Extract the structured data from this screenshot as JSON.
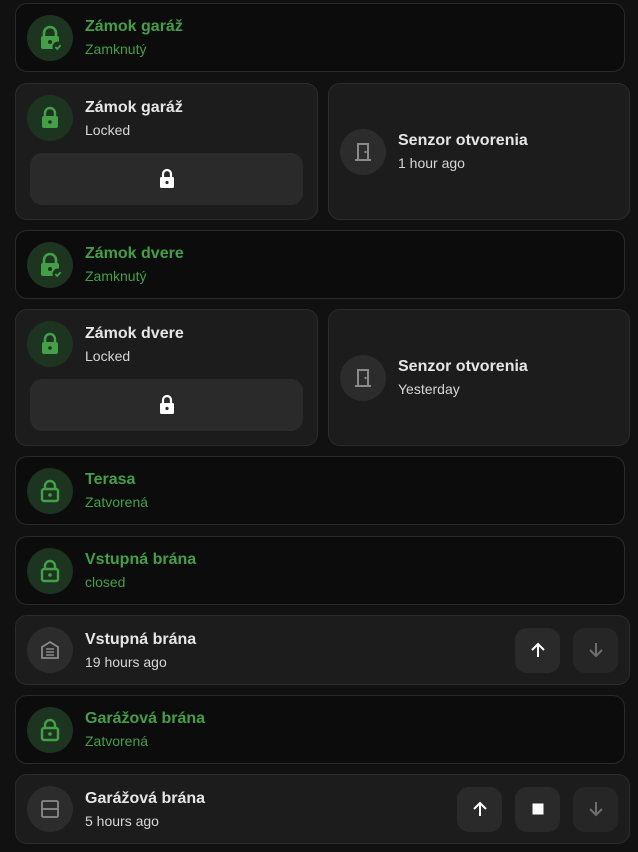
{
  "colors": {
    "accent_green": "#43a047",
    "card_dark": "#0c0c0c",
    "card_mid": "#1c1c1c"
  },
  "cards": [
    {
      "title": "Zámok garáž",
      "subtitle": "Zamknutý",
      "icon": "lock-check-icon"
    },
    {
      "title": "Zámok garáž",
      "subtitle": "Locked",
      "icon": "lock-icon",
      "button_icon": "lock-icon"
    },
    {
      "title": "Senzor otvorenia",
      "subtitle": "1 hour ago",
      "icon": "door-icon"
    },
    {
      "title": "Zámok dvere",
      "subtitle": "Zamknutý",
      "icon": "lock-check-icon"
    },
    {
      "title": "Zámok dvere",
      "subtitle": "Locked",
      "icon": "lock-icon",
      "button_icon": "lock-icon"
    },
    {
      "title": "Senzor otvorenia",
      "subtitle": "Yesterday",
      "icon": "door-icon"
    },
    {
      "title": "Terasa",
      "subtitle": "Zatvorená",
      "icon": "lock-outline-icon"
    },
    {
      "title": "Vstupná brána",
      "subtitle": "closed",
      "icon": "lock-outline-icon"
    },
    {
      "title": "Vstupná brána",
      "subtitle": "19 hours ago",
      "icon": "gate-icon",
      "controls": [
        "open",
        "close"
      ]
    },
    {
      "title": "Garážová brána",
      "subtitle": "Zatvorená",
      "icon": "lock-outline-icon"
    },
    {
      "title": "Garážová brána",
      "subtitle": "5 hours ago",
      "icon": "garage-icon",
      "controls": [
        "open",
        "stop",
        "close"
      ]
    }
  ]
}
